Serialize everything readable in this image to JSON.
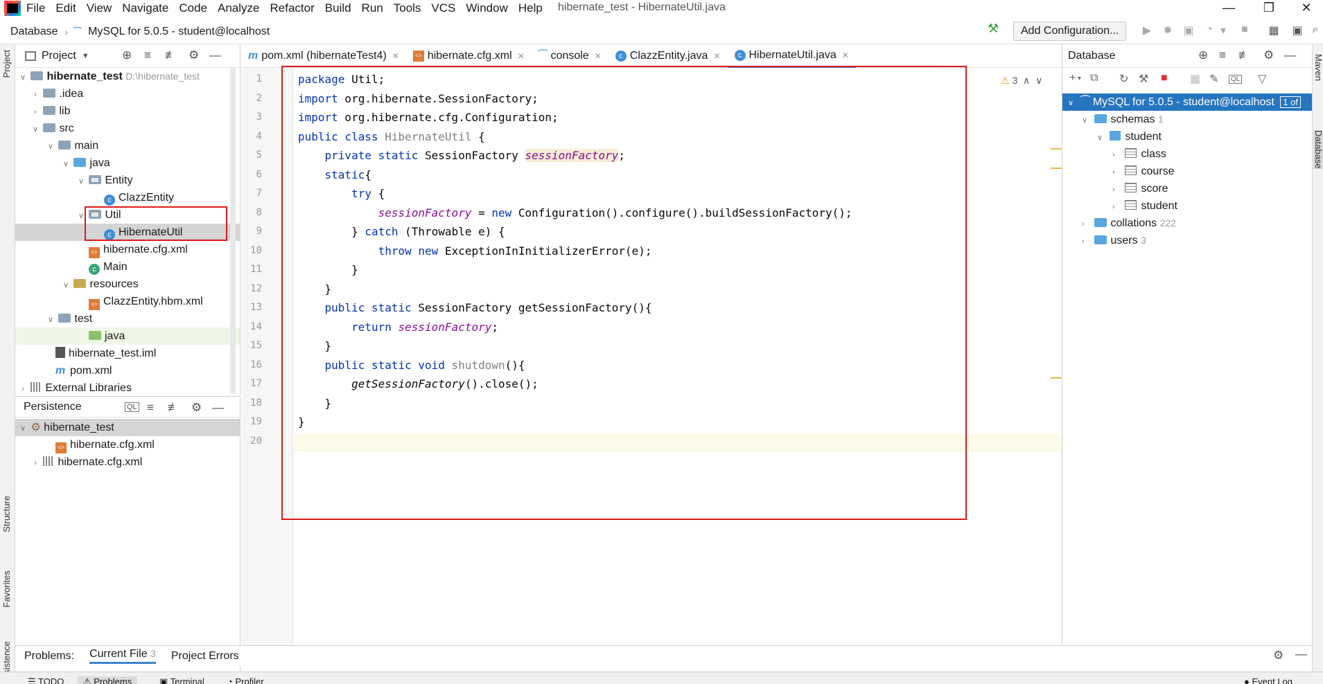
{
  "window": {
    "title": "hibernate_test - HibernateUtil.java",
    "menu": [
      "File",
      "Edit",
      "View",
      "Navigate",
      "Code",
      "Analyze",
      "Refactor",
      "Build",
      "Run",
      "Tools",
      "VCS",
      "Window",
      "Help"
    ],
    "minimize_glyph": "—",
    "restore_glyph": "❐",
    "close_glyph": "✕"
  },
  "navbar": {
    "crumb_1": "Database",
    "crumb_2": "MySQL for 5.0.5 - student@localhost",
    "add_configuration": "Add Configuration..."
  },
  "left_stripe": {
    "project": "Project",
    "structure": "Structure",
    "favorites": "Favorites",
    "persistence": "Persistence"
  },
  "right_stripe": {
    "maven": "Maven",
    "database": "Database"
  },
  "project_panel": {
    "title": "Project",
    "tree": [
      {
        "label": "hibernate_test",
        "extra": "D:\\hibernate_test"
      },
      {
        "label": ".idea"
      },
      {
        "label": "lib"
      },
      {
        "label": "src"
      },
      {
        "label": "main"
      },
      {
        "label": "java"
      },
      {
        "label": "Entity"
      },
      {
        "label": "ClazzEntity"
      },
      {
        "label": "Util"
      },
      {
        "label": "HibernateUtil"
      },
      {
        "label": "hibernate.cfg.xml"
      },
      {
        "label": "Main"
      },
      {
        "label": "resources"
      },
      {
        "label": "ClazzEntity.hbm.xml"
      },
      {
        "label": "test"
      },
      {
        "label": "java"
      },
      {
        "label": "hibernate_test.iml"
      },
      {
        "label": "pom.xml"
      },
      {
        "label": "External Libraries"
      }
    ]
  },
  "persistence_panel": {
    "title": "Persistence",
    "tree": [
      {
        "label": "hibernate_test"
      },
      {
        "label": "hibernate.cfg.xml"
      },
      {
        "label": "hibernate.cfg.xml"
      }
    ]
  },
  "editor": {
    "tabs": [
      {
        "label": "pom.xml (hibernateTest4)"
      },
      {
        "label": "hibernate.cfg.xml"
      },
      {
        "label": "console"
      },
      {
        "label": "ClazzEntity.java"
      },
      {
        "label": "HibernateUtil.java"
      }
    ],
    "warning_count": "3",
    "line_numbers": [
      "1",
      "2",
      "3",
      "4",
      "5",
      "6",
      "7",
      "8",
      "9",
      "10",
      "11",
      "12",
      "13",
      "14",
      "15",
      "16",
      "17",
      "18",
      "19",
      "20"
    ],
    "code": {
      "l1_kw": "package",
      "l1_rest": " Util;",
      "l2_kw": "import",
      "l2_rest": " org.hibernate.SessionFactory;",
      "l3_kw": "import",
      "l3_rest": " org.hibernate.cfg.Configuration;",
      "l4_kw": "public class",
      "l4_name": " HibernateUtil",
      "l4_rest": " {",
      "l5_kw": "    private static",
      "l5_type": " SessionFactory ",
      "l5_field": "sessionFactory",
      "l5_rest": ";",
      "l6_kw": "    static",
      "l6_rest": "{",
      "l7_kw": "        try",
      "l7_rest": " {",
      "l8_field": "            sessionFactory",
      "l8_mid": " = ",
      "l8_kw": "new",
      "l8_rest": " Configuration().configure().buildSessionFactory();",
      "l9_pre": "        } ",
      "l9_kw": "catch",
      "l9_rest": " (Throwable e) {",
      "l10_kw": "            throw new",
      "l10_rest": " ExceptionInInitializerError(e);",
      "l11": "        }",
      "l12": "    }",
      "l13_kw": "    public static",
      "l13_rest": " SessionFactory getSessionFactory(){",
      "l14_kw": "        return",
      "l14_sp": " ",
      "l14_field": "sessionFactory",
      "l14_rest": ";",
      "l15": "    }",
      "l16_kw": "    public static void",
      "l16_name": " shutdown",
      "l16_rest": "(){",
      "l17_itl": "        getSessionFactory",
      "l17_rest": "().close();",
      "l18": "    }",
      "l19": "}"
    }
  },
  "db_panel": {
    "title": "Database",
    "connection": "MySQL for 5.0.5 - student@localhost",
    "connection_badge": "1 of",
    "tree": [
      {
        "label": "schemas",
        "count": "1"
      },
      {
        "label": "student"
      },
      {
        "label": "class"
      },
      {
        "label": "course"
      },
      {
        "label": "score"
      },
      {
        "label": "student"
      },
      {
        "label": "collations",
        "count": "222"
      },
      {
        "label": "users",
        "count": "3"
      }
    ]
  },
  "problems": {
    "label": "Problems:",
    "tab_current": "Current File",
    "tab_current_count": "3",
    "tab_project": "Project Errors"
  },
  "bottom_tabs": {
    "todo": "TODO",
    "problems": "Problems",
    "terminal": "Terminal",
    "profiler": "Profiler",
    "event_log": "Event Log"
  }
}
